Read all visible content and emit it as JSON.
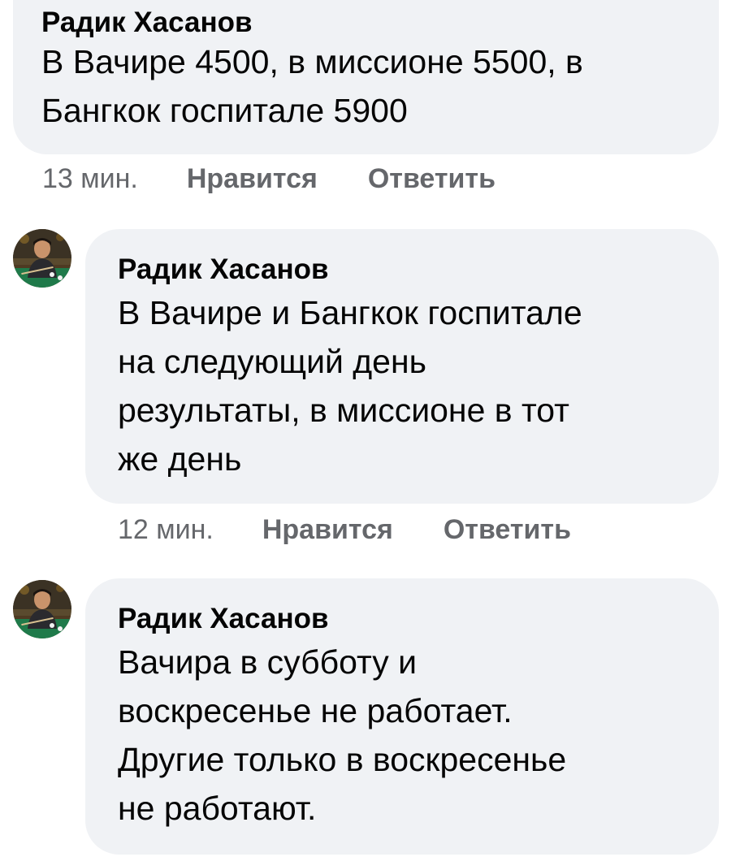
{
  "comments": [
    {
      "author": "Радик Хасанов",
      "text": "В Вачире 4500, в миссионе 5500, в\nБангкок госпитале 5900",
      "time": "13 мин.",
      "like_label": "Нравится",
      "reply_label": "Ответить"
    },
    {
      "author": "Радик Хасанов",
      "text": "В Вачире и Бангкок госпитале\nна следующий день\nрезультаты, в миссионе в тот\nже день",
      "time": "12 мин.",
      "like_label": "Нравится",
      "reply_label": "Ответить"
    },
    {
      "author": "Радик Хасанов",
      "text": "Вачира в субботу и\nвоскресенье не работает.\nДругие только в воскресенье\nне работают."
    }
  ],
  "colors": {
    "bubble_bg": "#f0f2f5",
    "text": "#050505",
    "meta_text": "#65676b"
  },
  "icons": {
    "avatar": "user-avatar-photo"
  }
}
